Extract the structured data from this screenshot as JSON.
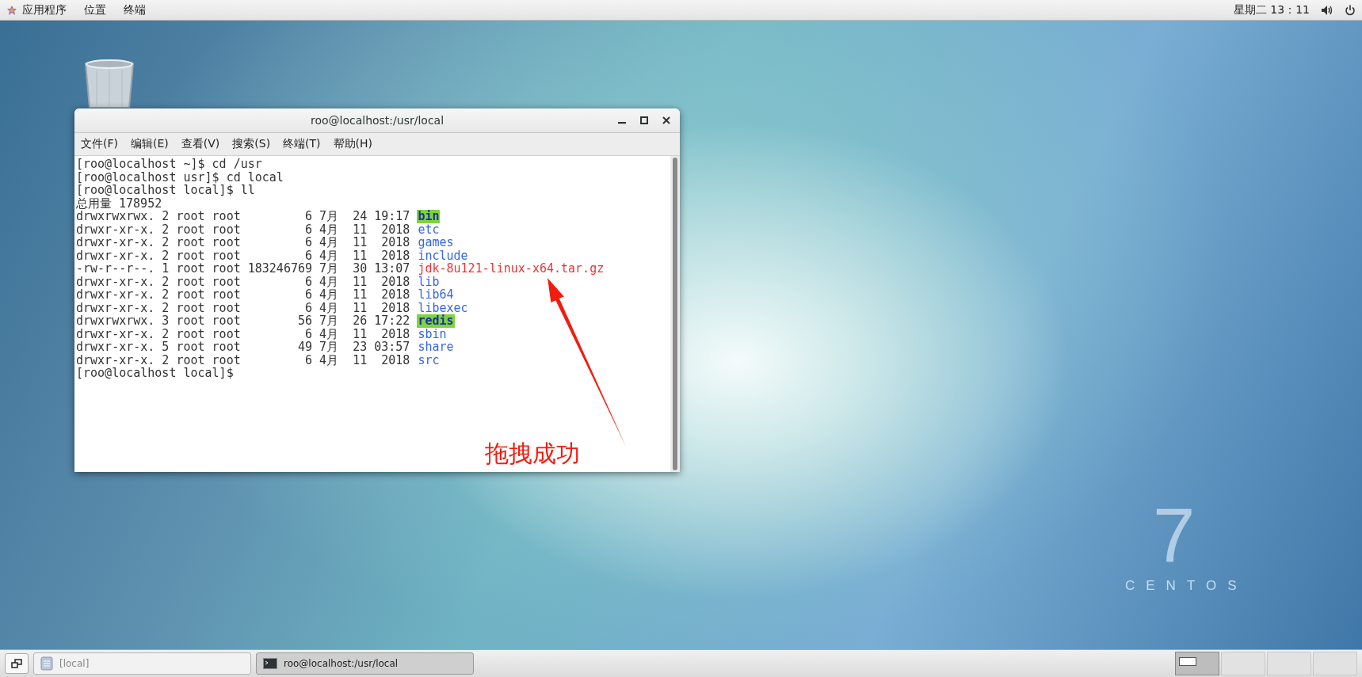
{
  "top_bar": {
    "menus": [
      "应用程序",
      "位置",
      "终端"
    ],
    "clock": "星期二 13：11"
  },
  "terminal": {
    "title": "roo@localhost:/usr/local",
    "menu": [
      "文件(F)",
      "编辑(E)",
      "查看(V)",
      "搜索(S)",
      "终端(T)",
      "帮助(H)"
    ],
    "lines": [
      {
        "kind": "text",
        "text": "[roo@localhost ~]$ cd /usr"
      },
      {
        "kind": "text",
        "text": "[roo@localhost usr]$ cd local"
      },
      {
        "kind": "text",
        "text": "[roo@localhost local]$ ll"
      },
      {
        "kind": "text",
        "text": "总用量 178952"
      },
      {
        "kind": "sticky_dir",
        "text": "drwxrwxrwx. 2 root root         6 7月  24 19:17",
        "name": "bin"
      },
      {
        "kind": "dir",
        "text": "drwxr-xr-x. 2 root root         6 4月  11  2018",
        "name": "etc"
      },
      {
        "kind": "dir",
        "text": "drwxr-xr-x. 2 root root         6 4月  11  2018",
        "name": "games"
      },
      {
        "kind": "dir",
        "text": "drwxr-xr-x. 2 root root         6 4月  11  2018",
        "name": "include"
      },
      {
        "kind": "archive",
        "text": "-rw-r--r--. 1 root root 183246769 7月  30 13:07",
        "name": "jdk-8u121-linux-x64.tar.gz"
      },
      {
        "kind": "dir",
        "text": "drwxr-xr-x. 2 root root         6 4月  11  2018",
        "name": "lib"
      },
      {
        "kind": "dir",
        "text": "drwxr-xr-x. 2 root root         6 4月  11  2018",
        "name": "lib64"
      },
      {
        "kind": "dir",
        "text": "drwxr-xr-x. 2 root root         6 4月  11  2018",
        "name": "libexec"
      },
      {
        "kind": "sticky_dir",
        "text": "drwxrwxrwx. 3 root root        56 7月  26 17:22",
        "name": "redis"
      },
      {
        "kind": "dir",
        "text": "drwxr-xr-x. 2 root root         6 4月  11  2018",
        "name": "sbin"
      },
      {
        "kind": "dir",
        "text": "drwxr-xr-x. 5 root root        49 7月  23 03:57",
        "name": "share"
      },
      {
        "kind": "dir",
        "text": "drwxr-xr-x. 2 root root         6 4月  11  2018",
        "name": "src"
      },
      {
        "kind": "text",
        "text": "[roo@localhost local]$"
      }
    ]
  },
  "annotation": {
    "caption": "拖拽成功"
  },
  "logo": {
    "number": "7",
    "wordmark": "CENTOS"
  },
  "taskbar": {
    "tasks": [
      {
        "label": "[local]",
        "kind": "folder",
        "selected": false
      },
      {
        "label": "roo@localhost:/usr/local",
        "kind": "terminal",
        "selected": true
      }
    ],
    "workspaces": [
      {
        "selected": true
      },
      {
        "selected": false
      },
      {
        "selected": false
      },
      {
        "selected": false
      }
    ]
  }
}
